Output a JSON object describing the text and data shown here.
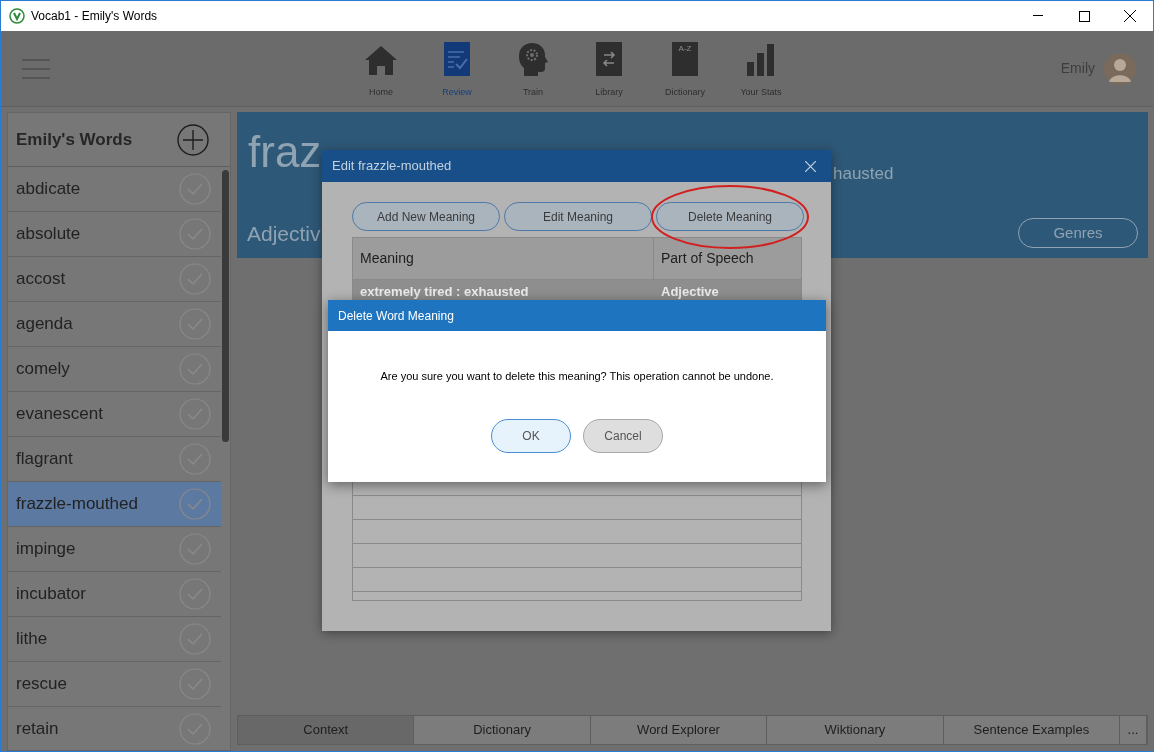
{
  "window": {
    "title": "Vocab1 - Emily's Words"
  },
  "nav": {
    "items": [
      {
        "label": "Home",
        "kind": "home",
        "selected": false
      },
      {
        "label": "Review",
        "kind": "review",
        "selected": true
      },
      {
        "label": "Train",
        "kind": "train",
        "selected": false
      },
      {
        "label": "Library",
        "kind": "library",
        "selected": false
      },
      {
        "label": "Dictionary",
        "kind": "dictionary",
        "icon_text": "A-Z",
        "selected": false
      },
      {
        "label": "Your Stats",
        "kind": "stats",
        "selected": false
      }
    ],
    "user": "Emily"
  },
  "sidebar": {
    "title": "Emily's Words",
    "words": [
      {
        "text": "abdicate",
        "selected": false
      },
      {
        "text": "absolute",
        "selected": false
      },
      {
        "text": "accost",
        "selected": false
      },
      {
        "text": "agenda",
        "selected": false
      },
      {
        "text": "comely",
        "selected": false
      },
      {
        "text": "evanescent",
        "selected": false
      },
      {
        "text": "flagrant",
        "selected": false
      },
      {
        "text": "frazzle-mouthed",
        "selected": true
      },
      {
        "text": "impinge",
        "selected": false
      },
      {
        "text": "incubator",
        "selected": false
      },
      {
        "text": "lithe",
        "selected": false
      },
      {
        "text": "rescue",
        "selected": false
      },
      {
        "text": "retain",
        "selected": false
      }
    ]
  },
  "word_header": {
    "word": "fraz",
    "definition": "hausted",
    "part_of_speech": "Adjectiv",
    "genres_button": "Genres"
  },
  "bottom_tabs": [
    {
      "label": "Context",
      "kind": "tab",
      "selected": true
    },
    {
      "label": "Dictionary",
      "kind": "tab",
      "selected": false
    },
    {
      "label": "Word Explorer",
      "kind": "tab",
      "selected": false
    },
    {
      "label": "Wiktionary",
      "kind": "tab",
      "selected": false
    },
    {
      "label": "Sentence Examples",
      "kind": "tab",
      "selected": false
    },
    {
      "label": "...",
      "kind": "more",
      "selected": false
    }
  ],
  "edit_dialog": {
    "title": "Edit frazzle-mouthed",
    "buttons": [
      {
        "label": "Add New Meaning",
        "circled": false
      },
      {
        "label": "Edit Meaning",
        "circled": false
      },
      {
        "label": "Delete Meaning",
        "circled": true
      }
    ],
    "table": {
      "columns": [
        "Meaning",
        "Part of Speech"
      ],
      "rows": [
        {
          "meaning": "extremely tired : exhausted",
          "part_of_speech": "Adjective"
        }
      ]
    }
  },
  "confirm_dialog": {
    "title": "Delete Word Meaning",
    "message": "Are you sure you want to delete this meaning? This operation cannot be undone.",
    "buttons": [
      {
        "label": "OK",
        "kind": "primary"
      },
      {
        "label": "Cancel",
        "kind": "secondary"
      }
    ]
  }
}
